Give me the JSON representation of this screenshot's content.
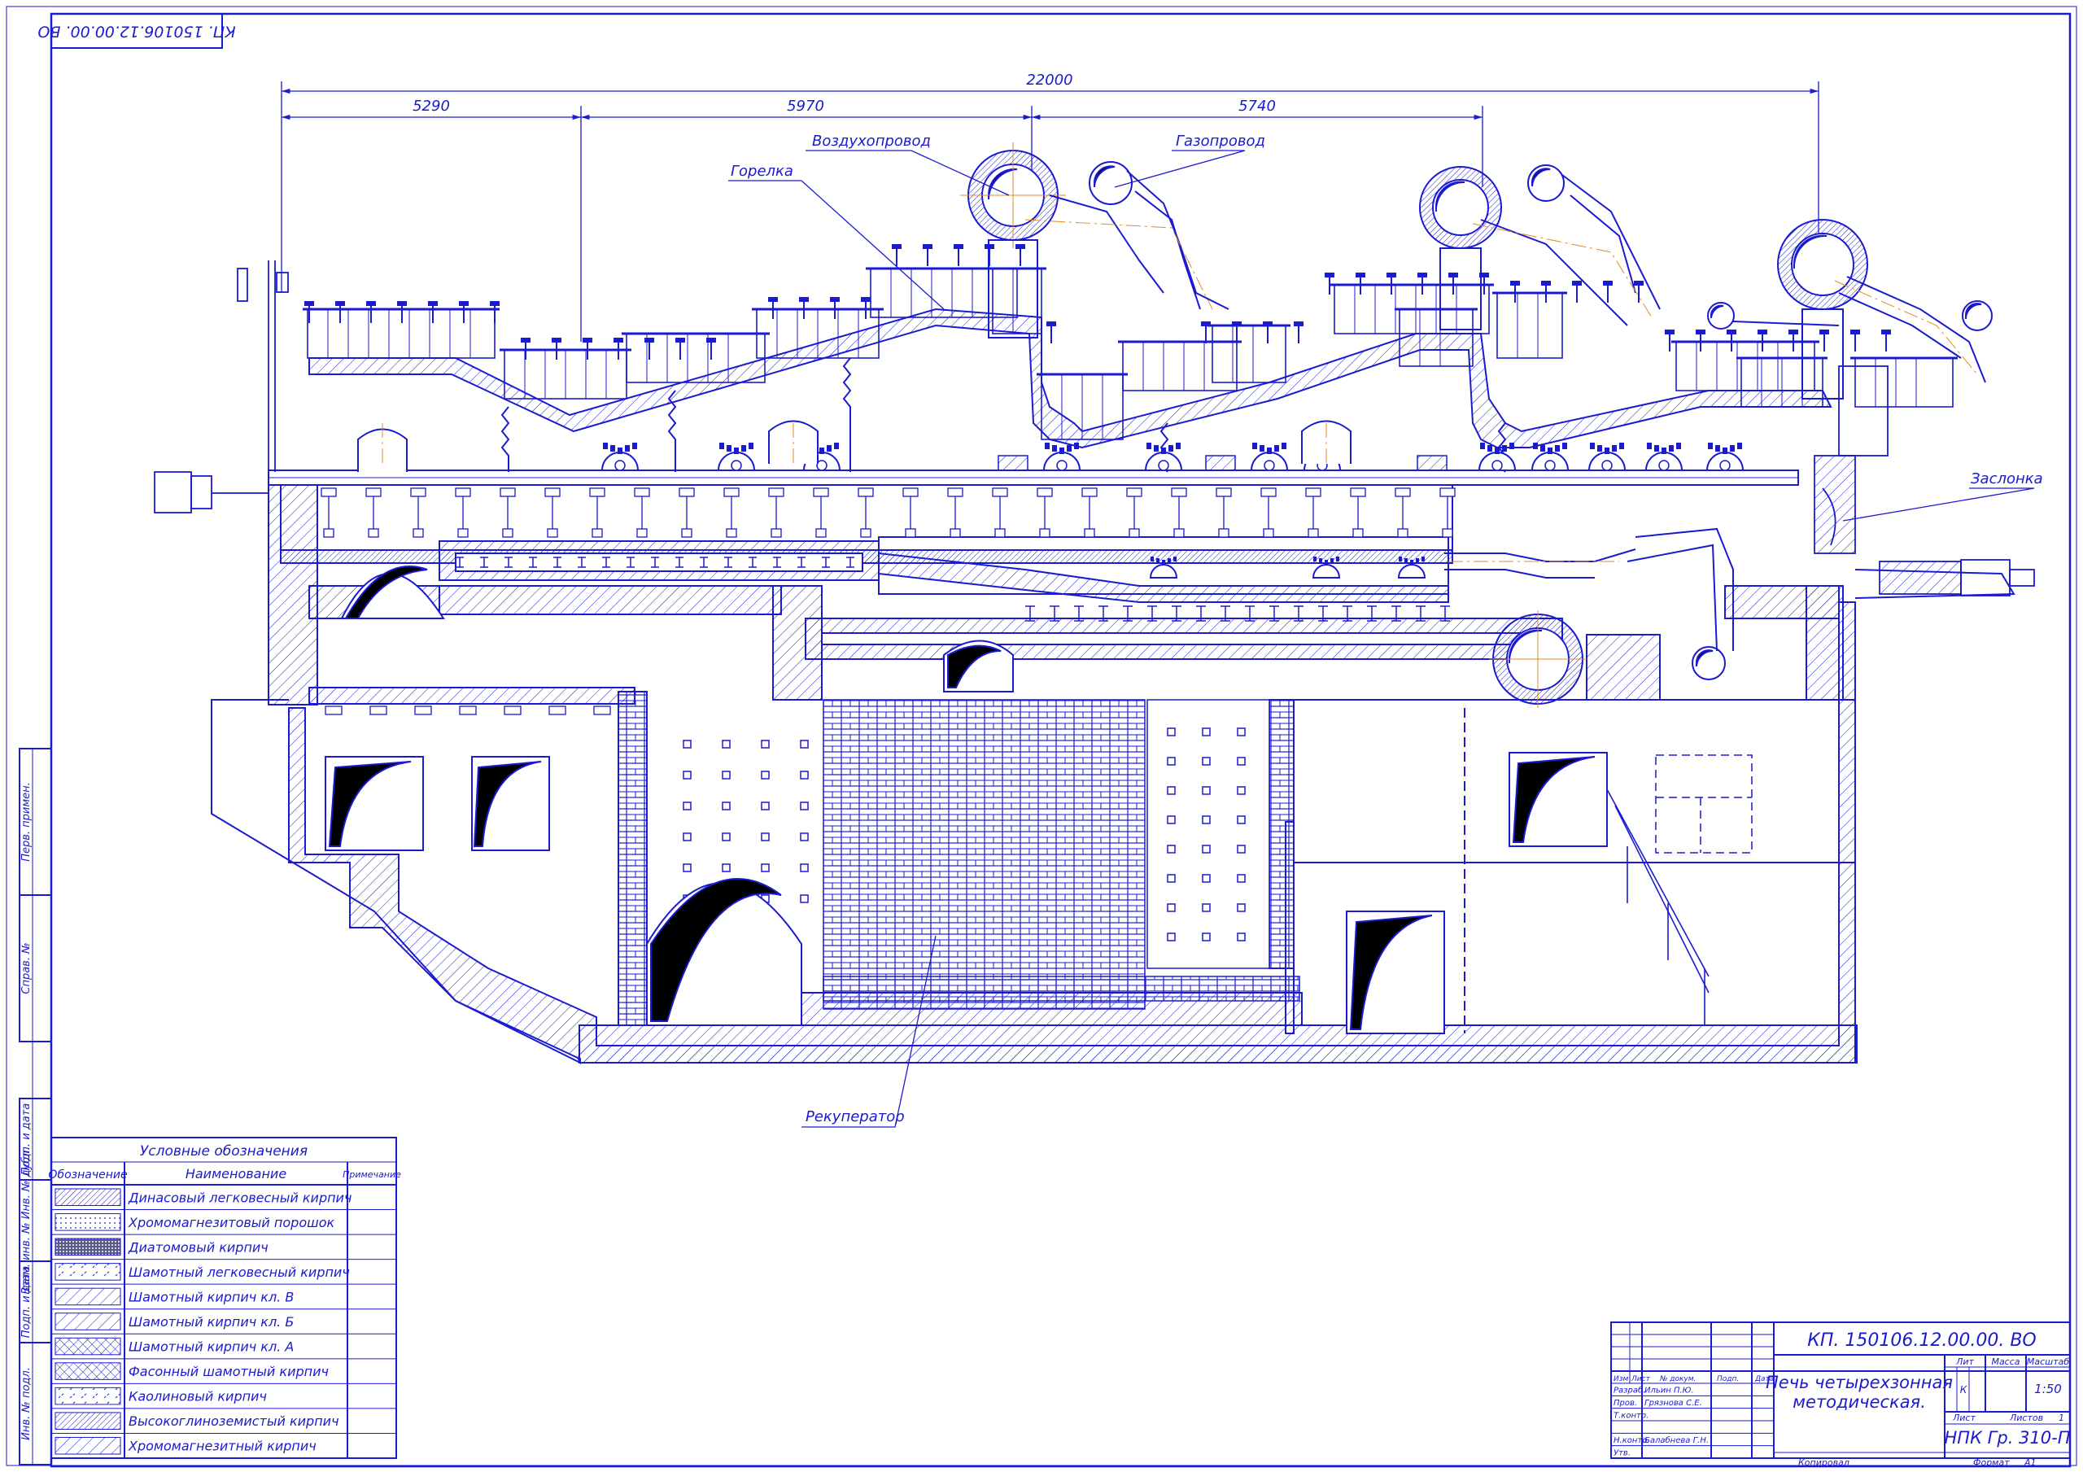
{
  "doc_code_rotated": "КП. 150106.12.00.00. ВО",
  "dimensions": {
    "total": "22000",
    "d1": "5290",
    "d2": "5970",
    "d3": "5740"
  },
  "callouts": {
    "burner": "Горелка",
    "air_duct": "Воздухопровод",
    "gas_duct": "Газопровод",
    "damper": "Заслонка",
    "recuperator": "Рекуператор"
  },
  "legend": {
    "title": "Условные обозначения",
    "col_designation": "Обозначение",
    "col_name": "Наименование",
    "col_note": "Примечание",
    "rows": [
      {
        "name": "Динасовый легковесный кирпич",
        "pattern": "dinas"
      },
      {
        "name": "Хромомагнезитовый порошок",
        "pattern": "powder"
      },
      {
        "name": "Диатомовый кирпич",
        "pattern": "diatom"
      },
      {
        "name": "Шамотный легковесный кирпич",
        "pattern": "shamot-light"
      },
      {
        "name": "Шамотный кирпич кл. В",
        "pattern": "shamot-v"
      },
      {
        "name": "Шамотный кирпич кл. Б",
        "pattern": "shamot-b"
      },
      {
        "name": "Шамотный кирпич кл. А",
        "pattern": "shamot-a"
      },
      {
        "name": "Фасонный шамотный кирпич",
        "pattern": "shaped"
      },
      {
        "name": "Каолиновый кирпич",
        "pattern": "kaolin"
      },
      {
        "name": "Высокоглиноземистый кирпич",
        "pattern": "alumina"
      },
      {
        "name": "Хромомагнезитный кирпич",
        "pattern": "chrome"
      }
    ]
  },
  "side_stamp": {
    "perv_primen": "Перв. примен.",
    "sprav": "Справ. №",
    "podp_data_1": "Подп. и дата",
    "inv_dubl": "Взам. инв. № Инв. № дубл.",
    "podp_data_2": "Подп. и дата",
    "inv_podl": "Инв. № подл."
  },
  "title_block": {
    "code": "КП. 150106.12.00.00. ВО",
    "name_line1": "Печь четырехзонная",
    "name_line2": "методическая.",
    "lit": "Лит",
    "massa": "Масса",
    "masshtab": "Масштаб",
    "lit_value": "К",
    "scale": "1:50",
    "list": "Лист",
    "listov": "Листов",
    "listov_value": "1",
    "org": "НПК Гр. 310-П",
    "kopiroval": "Копировал",
    "format": "Формат",
    "format_value": "А1",
    "hdr_izm": "Изм",
    "hdr_list": "Лист",
    "hdr_doc": "№ докум.",
    "hdr_podp": "Подп.",
    "hdr_data": "Дата",
    "roles": [
      {
        "role": "Разраб.",
        "name": "Ильин П.Ю."
      },
      {
        "role": "Пров.",
        "name": "Грязнова С.Е."
      },
      {
        "role": "Т.контр.",
        "name": ""
      },
      {
        "role": "",
        "name": ""
      },
      {
        "role": "Н.контр.",
        "name": "Балабнева Г.Н."
      },
      {
        "role": "Утв.",
        "name": ""
      }
    ]
  },
  "colors": {
    "ink": "#1a1ad0",
    "center_line": "#e08a2a"
  }
}
